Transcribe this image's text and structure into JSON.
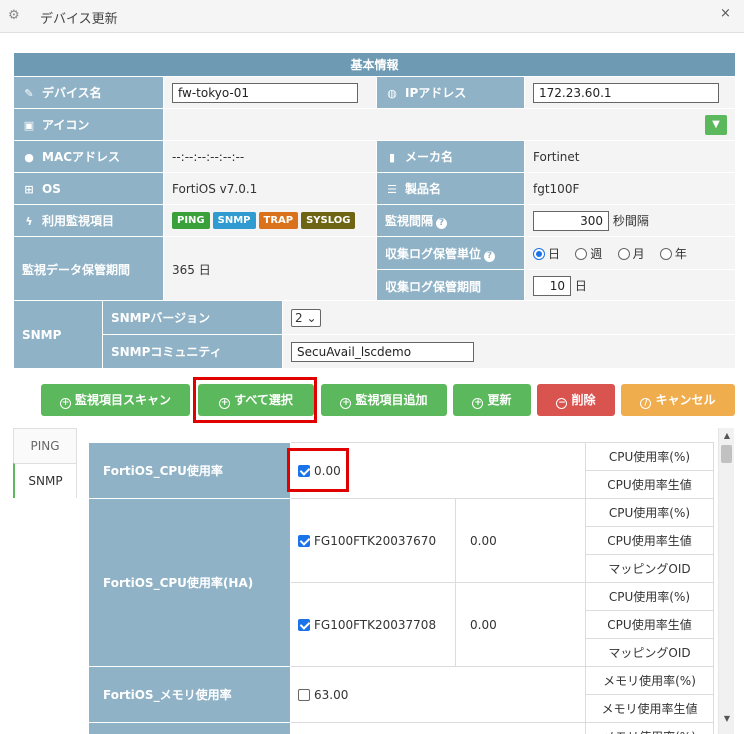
{
  "window": {
    "title": "デバイス更新",
    "close": "×"
  },
  "info": {
    "header": "基本情報",
    "device_name_label": "デバイス名",
    "device_name_value": "fw-tokyo-01",
    "ip_label": "IPアドレス",
    "ip_value": "172.23.60.1",
    "icon_label": "アイコン",
    "mac_label": "MACアドレス",
    "mac_value": "--:--:--:--:--:--",
    "maker_label": "メーカ名",
    "maker_value": "Fortinet",
    "os_label": "OS",
    "os_value": "FortiOS v7.0.1",
    "product_label": "製品名",
    "product_value": "fgt100F",
    "monitor_items_label": "利用監視項目",
    "badges": [
      "PING",
      "SNMP",
      "TRAP",
      "SYSLOG"
    ],
    "interval_label": "監視間隔",
    "interval_value": "300",
    "interval_unit": "秒間隔",
    "retention_label": "監視データ保管期間",
    "retention_value": "365 日",
    "log_unit_label": "収集ログ保管単位",
    "log_units": [
      "日",
      "週",
      "月",
      "年"
    ],
    "log_period_label": "収集ログ保管期間",
    "log_period_value": "10",
    "log_period_unit": "日",
    "snmp_label": "SNMP",
    "snmp_version_label": "SNMPバージョン",
    "snmp_version_value": "2",
    "snmp_community_label": "SNMPコミュニティ",
    "snmp_community_value": "SecuAvail_lscdemo"
  },
  "buttons": {
    "scan": "監視項目スキャン",
    "select_all": "すべて選択",
    "add": "監視項目追加",
    "update": "更新",
    "delete": "削除",
    "cancel": "キャンセル"
  },
  "tabs": [
    "PING",
    "SNMP"
  ],
  "grid": {
    "cpu": {
      "label": "FortiOS_CPU使用率",
      "value": "0.00",
      "sub": [
        "CPU使用率(%)",
        "CPU使用率生値"
      ]
    },
    "cpu_ha": {
      "label": "FortiOS_CPU使用率(HA)",
      "rows": [
        {
          "serial": "FG100FTK20037670",
          "value": "0.00"
        },
        {
          "serial": "FG100FTK20037708",
          "value": "0.00"
        }
      ],
      "sub": [
        "CPU使用率(%)",
        "CPU使用率生値",
        "マッピングOID"
      ]
    },
    "mem": {
      "label": "FortiOS_メモリ使用率",
      "value": "63.00",
      "sub": [
        "メモリ使用率(%)",
        "メモリ使用率生値"
      ]
    },
    "next_partial": "メモリ使用率(%)"
  },
  "colors": {
    "header": "#6e9bb3",
    "label": "#8fb2c6",
    "green": "#5cb85c",
    "red": "#d9534f",
    "orange": "#f0ad4e",
    "highlight": "#e00000"
  }
}
